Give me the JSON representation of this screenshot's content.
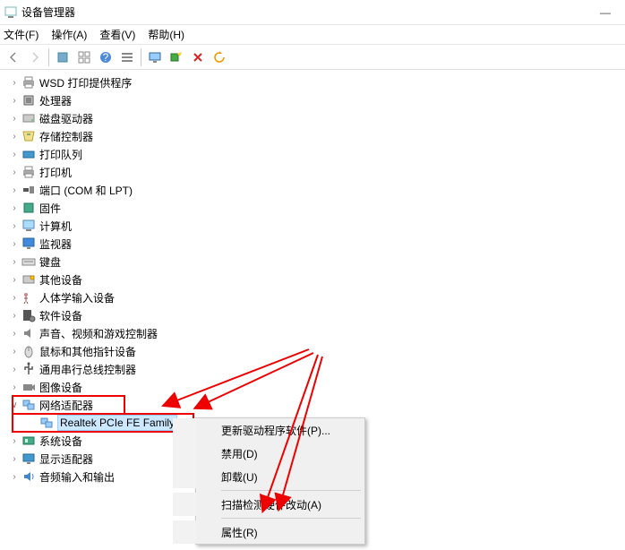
{
  "window": {
    "title": "设备管理器"
  },
  "menubar": {
    "file": "文件(F)",
    "action": "操作(A)",
    "view": "查看(V)",
    "help": "帮助(H)"
  },
  "tree": {
    "items": [
      "WSD 打印提供程序",
      "处理器",
      "磁盘驱动器",
      "存储控制器",
      "打印队列",
      "打印机",
      "端口 (COM 和 LPT)",
      "固件",
      "计算机",
      "监视器",
      "键盘",
      "其他设备",
      "人体学输入设备",
      "软件设备",
      "声音、视频和游戏控制器",
      "鼠标和其他指针设备",
      "通用串行总线控制器",
      "图像设备",
      "网络适配器",
      "系统设备",
      "显示适配器",
      "音频输入和输出"
    ],
    "expandedChild": "Realtek PCIe FE Family "
  },
  "context": {
    "update": "更新驱动程序软件(P)...",
    "disable": "禁用(D)",
    "uninstall": "卸载(U)",
    "scan": "扫描检测硬件改动(A)",
    "props": "属性(R)"
  }
}
